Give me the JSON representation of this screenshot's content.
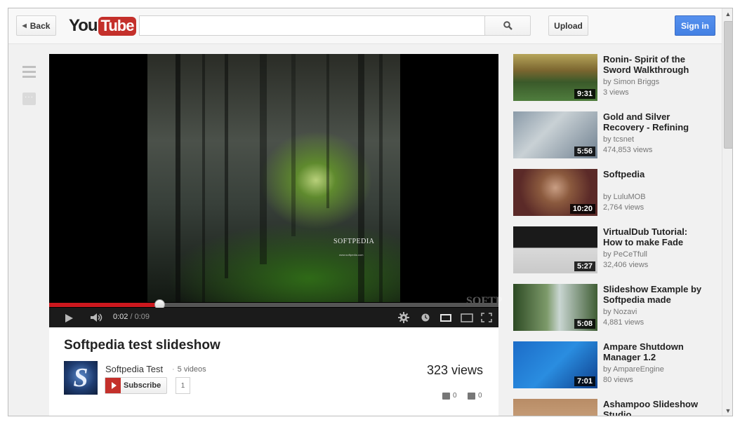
{
  "masthead": {
    "back_label": "Back",
    "logo_you": "You",
    "logo_tube": "Tube",
    "search_value": "",
    "upload_label": "Upload",
    "signin_label": "Sign in"
  },
  "player": {
    "current_time": "0:02",
    "separator": "/",
    "duration": "0:09",
    "progress_fraction": 0.245,
    "watermark_text": "SOFTPEDIA",
    "watermark_sub": "www.softpedia.com",
    "overlay_text": "SOFTP"
  },
  "video": {
    "title": "Softpedia test slideshow",
    "channel_name": "Softpedia Test",
    "channel_videos": "5 videos",
    "subscribe_label": "Subscribe",
    "subscriber_count": "1",
    "views": "323 views",
    "likes": "0",
    "dislikes": "0"
  },
  "related": [
    {
      "title": "Ronin- Spirit of the Sword Walkthrough",
      "by": "by Simon Briggs",
      "views": "3 views",
      "duration": "9:31"
    },
    {
      "title": "Gold and Silver Recovery - Refining",
      "by": "by tcsnet",
      "views": "474,853 views",
      "duration": "5:56"
    },
    {
      "title": "Softpedia",
      "by": "by LuluMOB",
      "views": "2,764 views",
      "duration": "10:20"
    },
    {
      "title": "VirtualDub Tutorial: How to make Fade",
      "by": "by PeCeTfull",
      "views": "32,406 views",
      "duration": "5:27"
    },
    {
      "title": "Slideshow Example by Softpedia made",
      "by": "by Nozavi",
      "views": "4,881 views",
      "duration": "5:08"
    },
    {
      "title": "Ampare Shutdown Manager 1.2",
      "by": "by AmpareEngine",
      "views": "80 views",
      "duration": "7:01"
    },
    {
      "title": "Ashampoo Slideshow Studio",
      "by": "",
      "views": "",
      "duration": ""
    }
  ],
  "colors": {
    "brand_red": "#c4302b",
    "progress_red": "#cc181e",
    "signin_blue": "#4d89ea"
  }
}
